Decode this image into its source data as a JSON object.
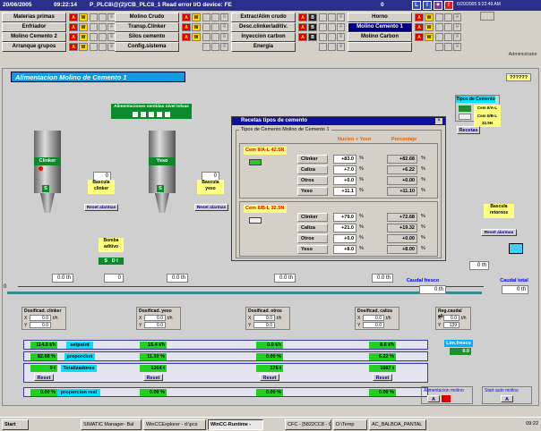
{
  "topbar": {
    "date": "20/06/2005",
    "time": "09:22:14",
    "message": "P_PLC8\\@(2)/CB_PLC8_1  Read error I/O device: FE",
    "counter": "0",
    "btn_l": "L",
    "btn_i": "I",
    "datetime": "6/20/2005 9:22:49 AM"
  },
  "nav": [
    {
      "label": "Materias primas",
      "ind": [
        "A",
        "W"
      ]
    },
    {
      "label": "Molino Crudo",
      "ind": [
        "A",
        "W"
      ]
    },
    {
      "label": "Extrac/Alim crudo",
      "ind": [
        "A",
        "B"
      ]
    },
    {
      "label": "Horno",
      "ind": [
        "A",
        "W"
      ]
    },
    {
      "label": "Enfriador",
      "ind": [
        "A",
        "W"
      ]
    },
    {
      "label": "Transp.Clinker",
      "ind": [
        "A",
        "W"
      ]
    },
    {
      "label": "Desc.clinker/aditiv.",
      "ind": [
        "A",
        "B"
      ]
    },
    {
      "label": "Molino Cemento 1",
      "ind": [
        "A",
        "W"
      ],
      "active": true
    },
    {
      "label": "Molino Cemento 2",
      "ind": [
        "A",
        "W"
      ]
    },
    {
      "label": "Silos cemento",
      "ind": [
        "A",
        "W"
      ]
    },
    {
      "label": "Inyeccion carbon",
      "ind": [
        "A",
        "B"
      ]
    },
    {
      "label": "Molino Carbon",
      "ind": [
        "A",
        "W"
      ]
    },
    {
      "label": "Arranque grupos",
      "ind": [
        "A",
        "W"
      ]
    },
    {
      "label": "Config.sistema",
      "ind": []
    },
    {
      "label": "Energia",
      "ind": []
    },
    {
      "label": "",
      "ind": []
    }
  ],
  "user": "Administrator",
  "page": {
    "title": "Alimentacion Molino de Cemento 1",
    "marker": "??????"
  },
  "sensors": {
    "title": "Alimentaciones sentidas nivel tolvas"
  },
  "cement_types": {
    "title": "Tipos de Cemento",
    "a": "Cem II/A-L 42.5R",
    "b": "Cem II/B-L 32.5N",
    "recetas": "Recetas"
  },
  "silos": [
    {
      "name": "Clinker",
      "scale": "Bascula clinker",
      "val": "0",
      "reset": "Reset alarmas"
    },
    {
      "name": "Yeso",
      "scale": "Bascula yeso",
      "val": "0",
      "reset": "Reset alarmas"
    }
  ],
  "additive": {
    "title": "Bomba aditivo",
    "s": "S",
    "d": "D",
    "i": "I",
    "val": "0"
  },
  "retornos": {
    "title": "Bascula retornos",
    "reset": "Reset alarmas"
  },
  "dialog": {
    "title": "Recetas tipos de cemento",
    "group": "Tipos de Cemento Molino de Cemento 1",
    "hdr_nucleo": "Nucleo + Yeso",
    "hdr_pct": "Porcentaje",
    "a": {
      "name": "Cem II/A-L 42.5R",
      "rows": [
        {
          "n": "Clinker",
          "v": "+83.0",
          "p": "+82.68"
        },
        {
          "n": "Caliza",
          "v": "+7.0",
          "p": "+6.22"
        },
        {
          "n": "Otros",
          "v": "+0.0",
          "p": "+0.00"
        },
        {
          "n": "Yeso",
          "v": "+11.1",
          "p": "+11.10"
        }
      ]
    },
    "b": {
      "name": "Cem II/B-L 32.5N",
      "rows": [
        {
          "n": "Clinker",
          "v": "+79.0",
          "p": "+72.68"
        },
        {
          "n": "Caliza",
          "v": "+21.0",
          "p": "+19.32"
        },
        {
          "n": "Otros",
          "v": "+0.0",
          "p": "+0.00"
        },
        {
          "n": "Yeso",
          "v": "+8.0",
          "p": "+8.00"
        }
      ]
    },
    "unit_pct": "%"
  },
  "flow": {
    "th": "0.0 th",
    "th0": "0 th",
    "caudal_fresco": "Caudal fresco",
    "caudal_total": "Caudal total",
    "zero": "0"
  },
  "dosif": [
    {
      "title": "Dosificad. clinker",
      "x": "0.0",
      "y": "0.0",
      "unit": "t/h"
    },
    {
      "title": "Dosificad. yeso",
      "x": "0.0",
      "y": "0.0",
      "unit": "t/h"
    },
    {
      "title": "Dosificad. otros",
      "x": "0.0",
      "y": "0.0",
      "unit": "t/h"
    },
    {
      "title": "Dosificad. caliza",
      "x": "0.0",
      "y": "0.0",
      "unit": "t/h"
    }
  ],
  "reg": {
    "title": "Reg.caudal alim.",
    "x": "0.0",
    "y": "139",
    "unit": "t/h",
    "lim": "Lim.fresco",
    "limval": "0.0"
  },
  "summary": {
    "setpoint": "setpoint",
    "proporcion": "proporcion",
    "totalizadores": "Totalizadores",
    "prop_real": "proporcion real",
    "sp": [
      "114.0 t/h",
      "15.4 t/h",
      "0.0 t/h",
      "8.6 t/h"
    ],
    "pr": [
      "82.68 %",
      "11.10 %",
      "0.00 %",
      "6.22 %"
    ],
    "tot": [
      "0 t",
      "1264 t",
      "176 t",
      "1887 t"
    ],
    "real": [
      "0.00 %",
      "0.00 %",
      "0.00 %",
      "0.00 %"
    ],
    "reset": "Reset"
  },
  "alim": {
    "label": "Alimentacion molino",
    "a": "A",
    "start": "Start auto molino",
    "sa": "A"
  },
  "taskbar": {
    "start": "Start",
    "tasks": [
      "SIMATIC Manager- Bal",
      "WinCCExplorer - d:\\pcs",
      "WinCC-Runtime -",
      "CFC - [5822CC8 - C8_",
      "D:\\Temp",
      "AC_BALBOA_PANTAL"
    ],
    "clock": "09:22"
  }
}
